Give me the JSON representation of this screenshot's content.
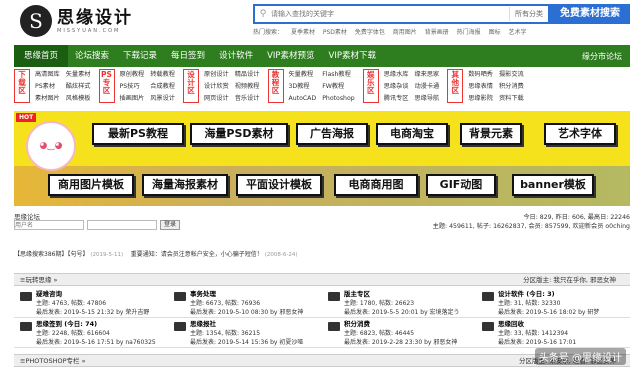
{
  "logo": {
    "mark": "S",
    "cn": "思缘设计",
    "en": "MISSYUAN.COM"
  },
  "search": {
    "placeholder": "请输入查找的关键字",
    "category": "所有分类",
    "button": "免费素材搜索"
  },
  "hotwords": [
    "热门搜索：",
    "夏季素材",
    "PSD素材",
    "免费字体包",
    "商用图片",
    "背景画册",
    "热门海报",
    "图标",
    "艺术字"
  ],
  "nav": {
    "items": [
      "思缘首页",
      "论坛搜索",
      "下载记录",
      "每日签到",
      "设计软件",
      "VIP素材预览",
      "VIP素材下载"
    ],
    "right": "缘分市论坛"
  },
  "cats": [
    {
      "tag": "下载区",
      "links": [
        "高清图库",
        "矢量素材",
        "PS素材",
        "酷炫样式",
        "素材图片",
        "风格模板"
      ]
    },
    {
      "tag": "PS专区",
      "links": [
        "原创教程",
        "转载教程",
        "PS技巧",
        "合成教程",
        "插画图片",
        "风景设计"
      ]
    },
    {
      "tag": "设计区",
      "links": [
        "原创设计",
        "精品设计",
        "设计欣赏",
        "视频教程",
        "网页设计",
        "音乐设计"
      ]
    },
    {
      "tag": "教程区",
      "links": [
        "矢量教程",
        "Flash教程",
        "3D教程",
        "FW教程",
        "AutoCAD",
        "Photoshop"
      ]
    },
    {
      "tag": "娱乐区",
      "links": [
        "思缘水库",
        "缘来思家",
        "思缘杂谈",
        "动漫卡通",
        "腾讯专区",
        "思缘导航"
      ]
    },
    {
      "tag": "其他区",
      "links": [
        "数码晒秀",
        "摄影交流",
        "思缘表情",
        "积分消费",
        "思缘影院",
        "资料下载"
      ]
    }
  ],
  "banner": {
    "hot": "HOT",
    "keywords": [
      "最新PS教程",
      "海量PSD素材",
      "广告海报",
      "电商淘宝",
      "背景元素",
      "艺术字体",
      "商用图片模板",
      "海量海报素材",
      "平面设计模板",
      "电商商用图",
      "GIF动图",
      "banner模板"
    ]
  },
  "forum": {
    "title": "思缘论坛",
    "username_placeholder": "用户名",
    "login": "登录",
    "stats_line1": "今日: 829, 昨日: 606, 最高日: 22246",
    "stats_line2": "主题: 459611, 帖子: 16262837, 会员: 857599, 欢迎新会员 o0ching"
  },
  "notice": [
    {
      "text": "【思缘搜索386期】【句号】",
      "date": "(2019-5-11)"
    },
    {
      "text": "重要通知：请会员注意帐户安全，小心骗子短信！",
      "date": "(2008-6-24)"
    }
  ],
  "section1": {
    "title": "≡玩转思缘 »",
    "mod": "分区版主: 我只在乎你, 邪恶女神"
  },
  "boards": [
    [
      {
        "name": "疑难咨询",
        "stat": "主题: 4763, 帖数: 47806",
        "last": "最后发表: 2019-5-15 21:32 by 荣升吉野"
      },
      {
        "name": "事务处理",
        "stat": "主题: 6673, 帖数: 76936",
        "last": "最后发表: 2019-5-10 08:30 by 邪恶女神"
      },
      {
        "name": "版主专区",
        "stat": "主题: 1780, 帖数: 26623",
        "last": "最后发表: 2019-5-5 20:01 by 宏境落定う"
      },
      {
        "name": "设计软件 (今日: 3)",
        "stat": "主题: 31, 帖数: 32330",
        "last": "最后发表: 2019-5-16 18:02 by 研梦"
      }
    ],
    [
      {
        "name": "思缘签到 (今日: 74)",
        "stat": "主题: 2248, 帖数: 616604",
        "last": "最后发表: 2019-5-16 17:51 by na760325"
      },
      {
        "name": "思缘报社",
        "stat": "主题: 1354, 帖数: 36215",
        "last": "最后发表: 2019-5-14 15:36 by 初夏沙哑"
      },
      {
        "name": "积分消费",
        "stat": "主题: 6823, 帖数: 46445",
        "last": "最后发表: 2019-2-28 23:30 by 邪恶女神"
      },
      {
        "name": "思缘回收",
        "stat": "主题: 33, 帖数: 1412394",
        "last": "最后发表: 2019-5-16 17:01"
      }
    ]
  ],
  "section2": {
    "title": "≡PHOTOSHOP专栏 »",
    "mod": "分区版主: 来安乐, 暖香, 邪恶女神"
  },
  "watermark": "头条号 @思缘设计"
}
